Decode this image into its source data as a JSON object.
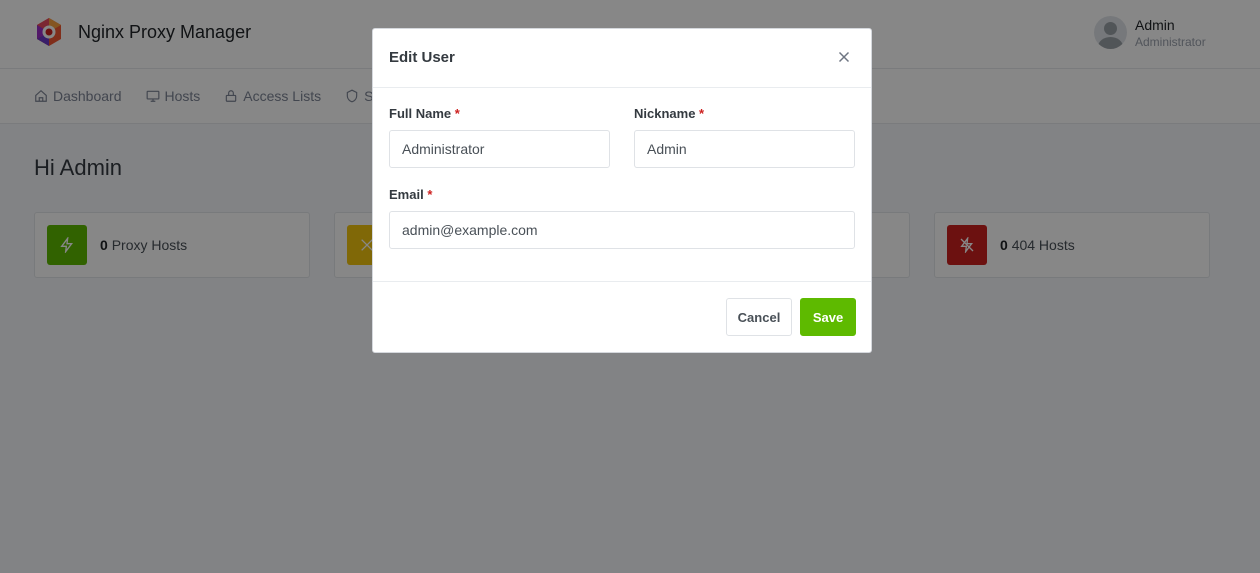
{
  "app": {
    "name": "Nginx Proxy Manager"
  },
  "user": {
    "name": "Admin",
    "role": "Administrator"
  },
  "nav": {
    "items": [
      {
        "label": "Dashboard",
        "icon": "home-icon"
      },
      {
        "label": "Hosts",
        "icon": "monitor-icon"
      },
      {
        "label": "Access Lists",
        "icon": "lock-icon"
      },
      {
        "label": "SSL",
        "icon": "shield-icon"
      }
    ]
  },
  "dashboard": {
    "greeting": "Hi Admin",
    "cards": [
      {
        "count": "0",
        "label": "Proxy Hosts",
        "icon": "zap-icon",
        "color": "#5eba00"
      },
      {
        "count": "",
        "label": "",
        "icon": "shuffle-icon",
        "color": "#f1c40f"
      },
      {
        "count": "",
        "label": "",
        "icon": "",
        "color": "#ffffff"
      },
      {
        "count": "0",
        "label": "404 Hosts",
        "icon": "zap-off-icon",
        "color": "#cd201f"
      }
    ]
  },
  "modal": {
    "title": "Edit User",
    "full_name_label": "Full Name",
    "full_name_value": "Administrator",
    "nickname_label": "Nickname",
    "nickname_value": "Admin",
    "email_label": "Email",
    "email_value": "admin@example.com",
    "required_mark": "*",
    "cancel_label": "Cancel",
    "save_label": "Save"
  },
  "colors": {
    "accent": "#5eba00",
    "danger": "#cd201f",
    "warning": "#f1c40f",
    "required": "#cd201f"
  }
}
